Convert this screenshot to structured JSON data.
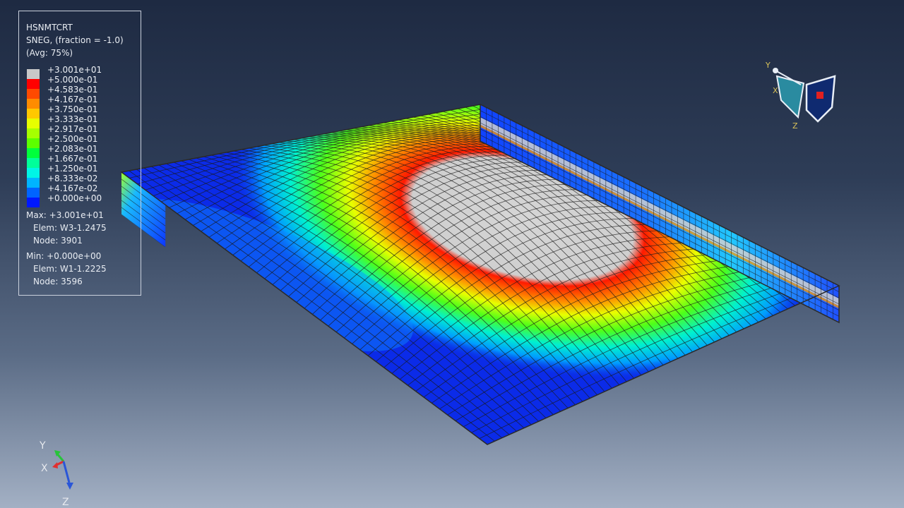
{
  "legend": {
    "variable": "HSNMTCRT",
    "section": "SNEG, (fraction = -1.0)",
    "averaging": "(Avg: 75%)",
    "levels": [
      {
        "label": "+3.001e+01",
        "color": "#c8c8c8"
      },
      {
        "label": "+5.000e-01",
        "color": "#ff0000"
      },
      {
        "label": "+4.583e-01",
        "color": "#ff4a00"
      },
      {
        "label": "+4.167e-01",
        "color": "#ff8c00"
      },
      {
        "label": "+3.750e-01",
        "color": "#ffc800"
      },
      {
        "label": "+3.333e-01",
        "color": "#e6ff00"
      },
      {
        "label": "+2.917e-01",
        "color": "#a6ff00"
      },
      {
        "label": "+2.500e-01",
        "color": "#5cff00"
      },
      {
        "label": "+2.083e-01",
        "color": "#00ff3c"
      },
      {
        "label": "+1.667e-01",
        "color": "#00ff9a"
      },
      {
        "label": "+1.250e-01",
        "color": "#00f5e6"
      },
      {
        "label": "+8.333e-02",
        "color": "#00b4ff"
      },
      {
        "label": "+4.167e-02",
        "color": "#0064ff"
      },
      {
        "label": "+0.000e+00",
        "color": "#0018ff"
      }
    ],
    "max_line": "Max: +3.001e+01",
    "max_elem": "Elem: W3-1.2475",
    "max_node": "Node: 3901",
    "min_line": "Min: +0.000e+00",
    "min_elem": "Elem: W1-1.2225",
    "min_node": "Node: 3596"
  },
  "triad": {
    "x": "X",
    "y": "Y",
    "z": "Z",
    "x_color": "#e03030",
    "y_color": "#27c43a",
    "z_color": "#2a56d8"
  },
  "view_cube": {
    "x": "X",
    "y": "Y",
    "z": "Z"
  },
  "model": {
    "mesh_line_color": "#1a1a1a",
    "edge_color": "#2a2a2a"
  }
}
